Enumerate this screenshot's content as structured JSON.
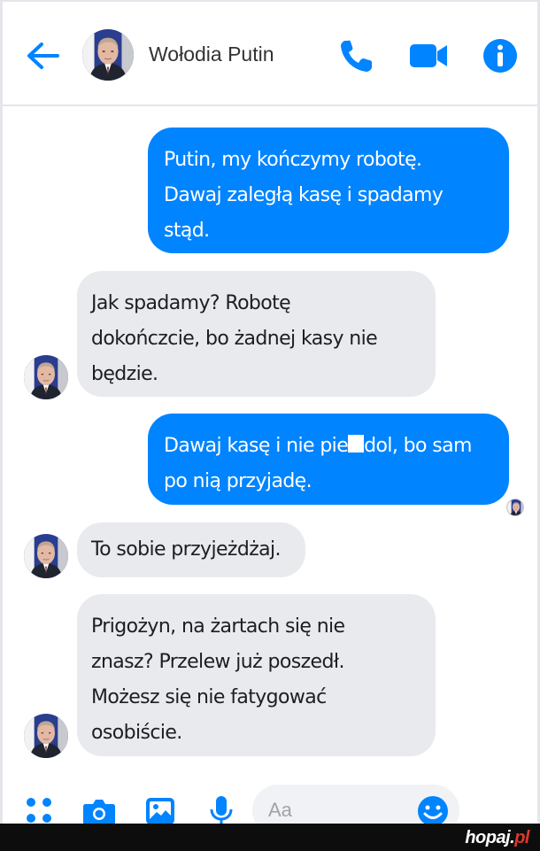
{
  "header": {
    "contact_name": "Wołodia Putin",
    "back_icon": "arrow-left-icon",
    "call_icon": "phone-icon",
    "video_icon": "video-camera-icon",
    "info_icon": "info-icon",
    "accent_color": "#0084ff"
  },
  "messages": [
    {
      "direction": "outgoing",
      "lines": [
        "Putin, my kończymy robotę.",
        "Dawaj zaległą kasę i spadamy",
        "stąd."
      ]
    },
    {
      "direction": "incoming",
      "lines": [
        "Jak spadamy? Robotę",
        "dokończcie, bo żadnej kasy nie",
        "będzie."
      ]
    },
    {
      "direction": "outgoing",
      "lines_parts": [
        "Dawaj kasę i nie pie",
        "dol, bo sam"
      ],
      "lines": [
        "po nią przyjadę."
      ]
    },
    {
      "direction": "incoming",
      "lines": [
        "To sobie przyjeżdżaj."
      ]
    },
    {
      "direction": "incoming",
      "lines": [
        "Prigożyn, na żartach się nie",
        "znasz? Przelew już poszedł.",
        "Możesz się nie fatygować",
        "osobiście."
      ]
    }
  ],
  "composer": {
    "placeholder": "Aa",
    "apps_icon": "apps-grid-icon",
    "camera_icon": "camera-icon",
    "gallery_icon": "image-icon",
    "mic_icon": "microphone-icon",
    "emoji_icon": "smiley-icon"
  },
  "watermark": {
    "name": "hopaj",
    "dot": ".",
    "tld": "pl"
  },
  "colors": {
    "outgoing_bubble": "#0084ff",
    "incoming_bubble": "#e9eaee",
    "footer": "#0d0d0d",
    "watermark_accent": "#d93a2b"
  }
}
